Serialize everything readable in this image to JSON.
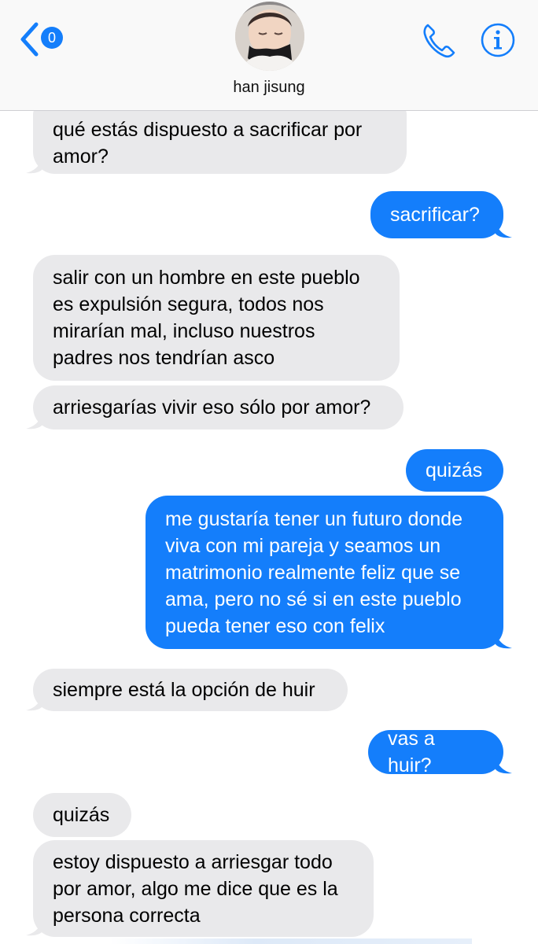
{
  "header": {
    "back_count": "0",
    "contact_name": "han jisung",
    "icons": {
      "back": "chevron-left-icon",
      "call": "phone-icon",
      "info": "info-icon",
      "avatar": "contact-avatar"
    },
    "accent_color": "#147efb"
  },
  "messages": [
    {
      "from": "contact",
      "text": "qué estás dispuesto a sacrificar por\namor?"
    },
    {
      "from": "me",
      "text": "sacrificar?"
    },
    {
      "from": "contact",
      "text": "salir con un hombre en este pueblo\nes expulsión segura, todos nos\nmirarían mal, incluso nuestros\npadres nos tendrían asco"
    },
    {
      "from": "contact",
      "text": "arriesgarías vivir eso sólo por amor?"
    },
    {
      "from": "me",
      "text": "quizás"
    },
    {
      "from": "me",
      "text": "me gustaría tener un futuro donde\nviva con mi pareja y seamos un\nmatrimonio realmente feliz que se\nama, pero no sé si en este pueblo\npueda tener eso con felix"
    },
    {
      "from": "contact",
      "text": "siempre está la opción de huir"
    },
    {
      "from": "me",
      "text": "vas a huir?"
    },
    {
      "from": "contact",
      "text": "quizás"
    },
    {
      "from": "contact",
      "text": "estoy dispuesto a arriesgar todo\npor amor, algo me dice que es la\npersona correcta"
    }
  ],
  "colors": {
    "incoming_bubble": "#e9e9eb",
    "outgoing_bubble": "#147efb"
  }
}
